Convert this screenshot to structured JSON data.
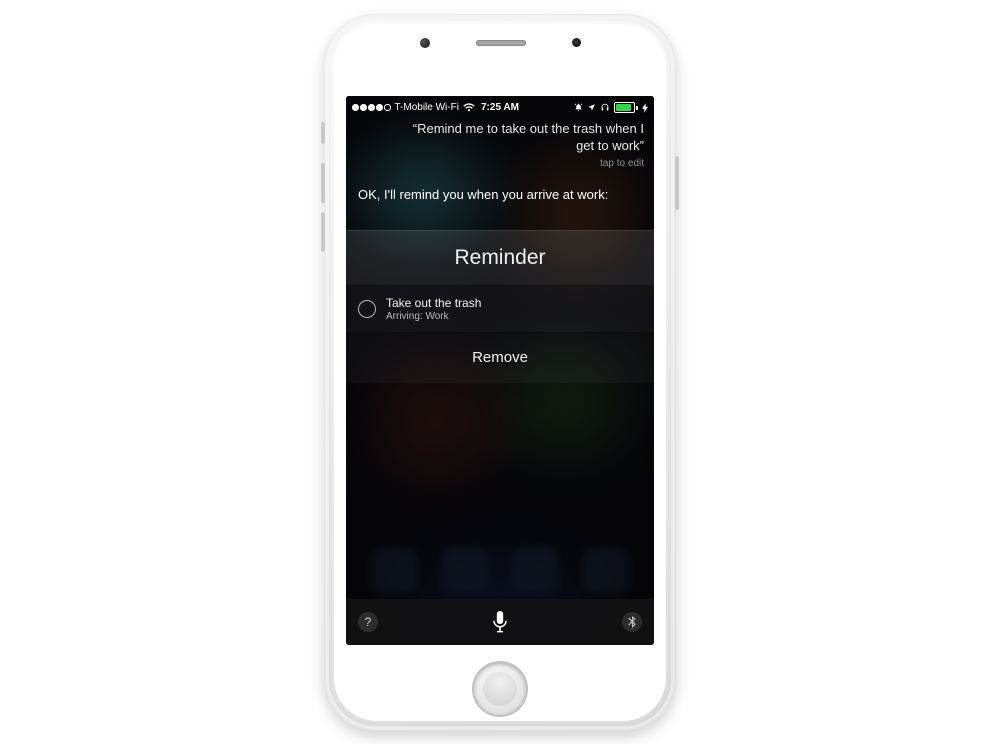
{
  "status": {
    "signal_filled": 4,
    "carrier": "T-Mobile Wi-Fi",
    "time": "7:25 AM",
    "battery_pct": 80
  },
  "siri": {
    "user_query": "“Remind me to take out the trash when I get to work”",
    "tap_to_edit": "tap to edit",
    "response": "OK, I'll remind you when you arrive at work:"
  },
  "card": {
    "header": "Reminder",
    "item_title": "Take out the trash",
    "item_subtitle": "Arriving: Work",
    "remove_label": "Remove"
  },
  "bottom": {
    "help_glyph": "?"
  }
}
